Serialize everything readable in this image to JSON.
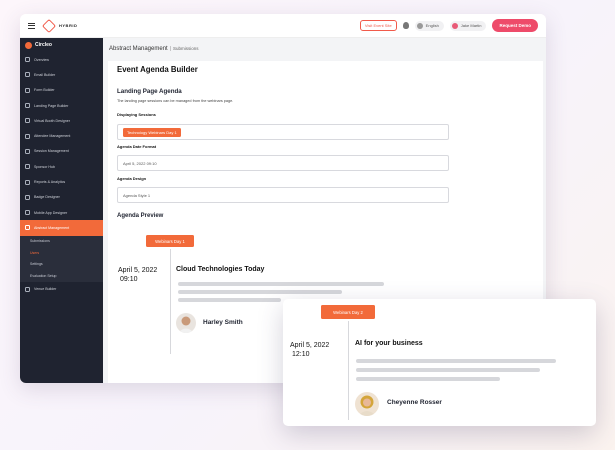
{
  "topbar": {
    "logo_text": "HYBRID",
    "visit_label": "Visit Event Site",
    "language": "English",
    "user": "Jake Martin",
    "request_label": "Request Demo",
    "icons": [
      "hamburger-icon",
      "lightbulb-icon"
    ]
  },
  "sidebar": {
    "brand": "Circleo",
    "items": [
      "Overview",
      "Email Builder",
      "Form Builder",
      "Landing Page Builder",
      "Virtual Booth Designer",
      "Attendee Management",
      "Session Management",
      "Sponsor Hub",
      "Reports & Analytics",
      "Badge Designer",
      "Mobile App Designer",
      "Abstract Management"
    ],
    "active_item": "Abstract Management",
    "sub_items": [
      "Submissions",
      "Users",
      "Settings",
      "Evaluation Setup"
    ],
    "active_sub": "Users",
    "footer_item": "Venue Builder"
  },
  "main": {
    "breadcrumb_title": "Abstract Management",
    "breadcrumb_sep": "|",
    "breadcrumb_sub": "Submissions",
    "builder_title": "Event Agenda Builder",
    "agenda": {
      "heading": "Landing Page Agenda",
      "description": "The landing page sessions can be managed from the webinars page.",
      "displaying_label": "Displaying Sessions",
      "displaying_chip": "Technology Webinars Day 1",
      "date_label": "Agenda Date Format",
      "date_value": "April 5, 2022 09:10",
      "design_label": "Agenda Design",
      "design_value": "Agenda Style 1"
    },
    "preview": {
      "heading": "Agenda Preview",
      "tag": "Webinars Day 1",
      "date_line1": "April 5, 2022",
      "date_line2": "09:10",
      "session_title": "Cloud Technologies Today",
      "speaker": "Harley Smith"
    }
  },
  "floating": {
    "tag": "Webinars Day 2",
    "date_line1": "April 5, 2022",
    "date_line2": "12:10",
    "session_title": "AI for your business",
    "speaker": "Cheyenne Rosser"
  },
  "colors": {
    "accent": "#f26a3a",
    "cta": "#ee4b6a",
    "sidebar_bg": "#1f2330"
  }
}
